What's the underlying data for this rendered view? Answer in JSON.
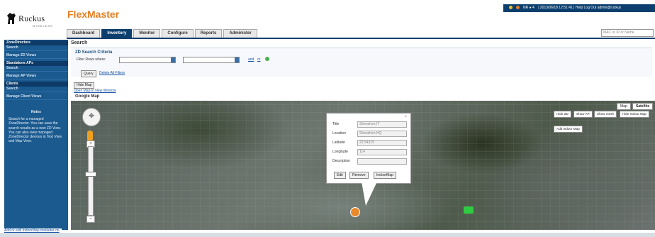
{
  "brand": {
    "name": "Ruckus",
    "sub": "WIRELESS",
    "product": "FlexMaster"
  },
  "status": {
    "text": "| 2013/06/18 12:51:41 | Help Log Out admin@ruckus",
    "alerts": "NR ● 4"
  },
  "tabs": [
    {
      "label": "Dashboard"
    },
    {
      "label": "Inventory"
    },
    {
      "label": "Monitor"
    },
    {
      "label": "Configure"
    },
    {
      "label": "Reports"
    },
    {
      "label": "Administer"
    }
  ],
  "search_placeholder": "MAC or IP or Name",
  "sidebar": {
    "sections": [
      {
        "head": "ZoneDirectors",
        "items": [
          "Search",
          "Manage ZD Views"
        ]
      },
      {
        "head": "Standalone APs",
        "items": [
          "Search",
          "Manage AP Views"
        ]
      },
      {
        "head": "Clients",
        "items": [
          "Search",
          "Manage Client Views"
        ]
      }
    ],
    "notes_title": "Notes",
    "notes_text": "Search for a managed ZoneDirector. You can save the search results as a new ZD View. You can also view managed ZoneDirector devices in Text View and Map View."
  },
  "page": {
    "title": "Search",
    "criteria_title": "ZD Search Criteria",
    "filter_label": "Filter Rows where:",
    "and_label": "and",
    "or_label": "or",
    "query_button": "Query",
    "clear_link": "Delete All Filters",
    "hide_map": "Hide Map",
    "open_map": "Open Map In New Window",
    "google_map": "Google Map"
  },
  "map": {
    "types": [
      "Map",
      "Satellite"
    ],
    "buttons": [
      "Hide ZD",
      "Show AP",
      "Show mesh",
      "Hide Indoor Map"
    ],
    "add_indoor": "Add Indoor Map",
    "popup": {
      "title_label": "Title",
      "title_value": "Shenzhen IT",
      "location_label": "Location",
      "location_value": "Shenzhen HQ",
      "latitude_label": "Latitude",
      "latitude_value": "22.54315",
      "longitude_label": "Longitude",
      "longitude_value": "114",
      "description_label": "Description",
      "description_value": "",
      "edit": "Edit",
      "remove": "Remove",
      "indoor": "IndoorMap"
    }
  },
  "footer_link": "Add or edit IndoorMap marketer on"
}
